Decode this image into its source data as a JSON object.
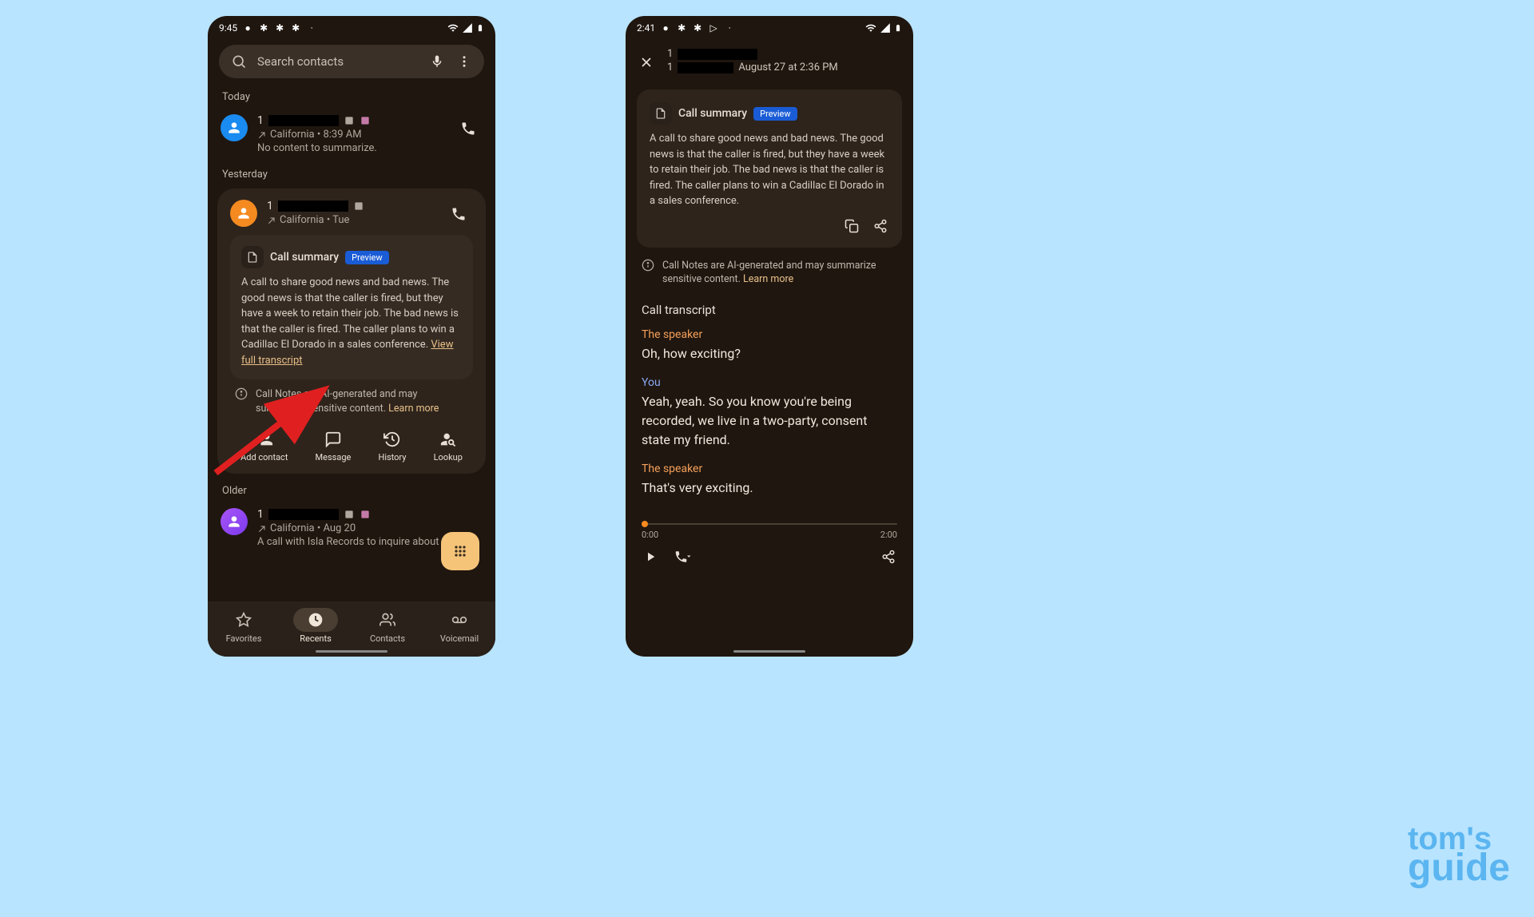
{
  "phone1": {
    "status_time": "9:45",
    "search_placeholder": "Search contacts",
    "sections": {
      "today": "Today",
      "yesterday": "Yesterday",
      "older": "Older"
    },
    "call_today": {
      "number_prefix": "1",
      "location_time": "California • 8:39 AM",
      "summary": "No content to summarize."
    },
    "call_yesterday": {
      "number_prefix": "1",
      "location_time": "California • Tue"
    },
    "summary_card": {
      "title": "Call summary",
      "badge": "Preview",
      "text": "A call to share good news and bad news. The good news is that the caller is fired, but they have a week to retain their job. The bad news is that the caller is fired. The caller plans to win a Cadillac El Dorado in a sales conference. ",
      "view_link": "View full transcript"
    },
    "disclaimer": {
      "text": "Call Notes are AI-generated and may summarize sensitive content. ",
      "learn_more": "Learn more"
    },
    "actions": {
      "add_contact": "Add contact",
      "message": "Message",
      "history": "History",
      "lookup": "Lookup"
    },
    "call_older": {
      "number_prefix": "1",
      "location_time": "California • Aug 20",
      "summary": "A call with Isla Records to inquire about pro"
    },
    "nav": {
      "favorites": "Favorites",
      "recents": "Recents",
      "contacts": "Contacts",
      "voicemail": "Voicemail"
    }
  },
  "phone2": {
    "status_time": "2:41",
    "header_prefix1": "1",
    "header_prefix2": "1",
    "header_date": "August 27 at 2:36 PM",
    "summary_card": {
      "title": "Call summary",
      "badge": "Preview",
      "text": "A call to share good news and bad news. The good news is that the caller is fired, but they have a week to retain their job. The bad news is that the caller is fired. The caller plans to win a Cadillac El Dorado in a sales conference."
    },
    "disclaimer": {
      "text": "Call Notes are AI-generated and may summarize sensitive content. ",
      "learn_more": "Learn more"
    },
    "transcript_title": "Call transcript",
    "transcript": [
      {
        "speaker": "The speaker",
        "class": "speaker-1",
        "text": "Oh, how exciting?"
      },
      {
        "speaker": "You",
        "class": "speaker-2",
        "text": "Yeah, yeah. So you know you're being recorded, we live in a two-party, consent state my friend."
      },
      {
        "speaker": "The speaker",
        "class": "speaker-1",
        "text": "That's very exciting."
      }
    ],
    "player": {
      "current": "0:00",
      "total": "2:00"
    }
  },
  "watermark": {
    "line1": "tom's",
    "line2": "guide"
  }
}
